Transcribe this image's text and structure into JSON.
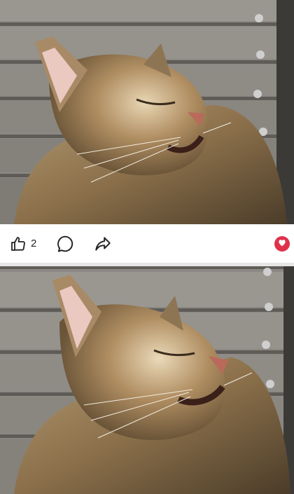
{
  "posts": [
    {
      "image": {
        "subject": "cat"
      },
      "actions": {
        "like_icon": "thumbs-up-icon",
        "like_count": "2",
        "comment_icon": "comment-icon",
        "share_icon": "share-icon",
        "reaction_icon": "heart-icon"
      }
    },
    {
      "image": {
        "subject": "cat"
      }
    }
  ],
  "colors": {
    "heart": "#e0314b",
    "icon_stroke": "#222222",
    "divider": "#e6e6e6"
  }
}
